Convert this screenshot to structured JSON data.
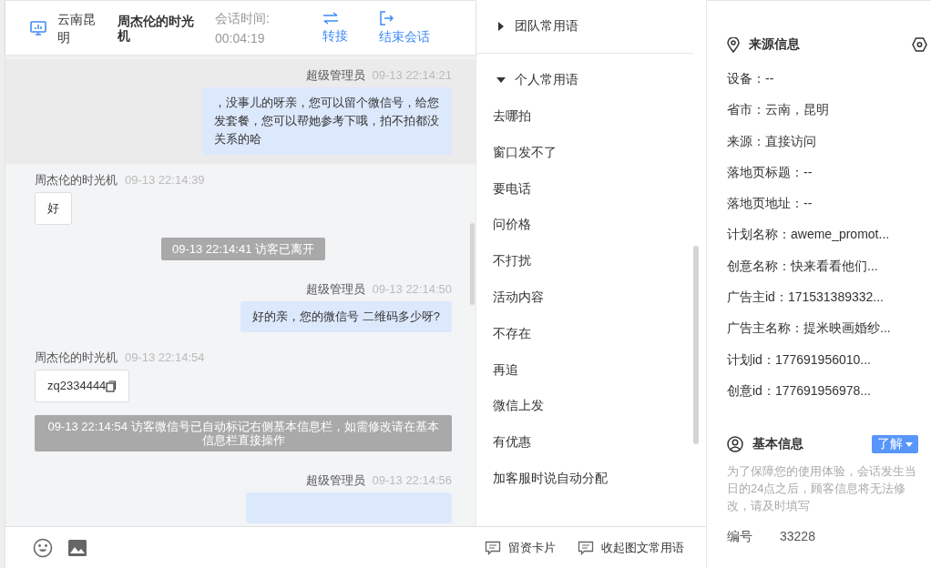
{
  "header": {
    "location": "云南昆明",
    "visitor": "周杰伦的时光机",
    "duration_label": "会话时间:",
    "duration": "00:04:19",
    "actions": [
      {
        "kind": "transfer",
        "label": "转接"
      },
      {
        "kind": "end",
        "label": "结束会话"
      }
    ]
  },
  "messages": [
    {
      "kind": "agent",
      "sender": "超级管理员",
      "time": "09-13 22:14:21",
      "text": "，没事儿的呀亲，您可以留个微信号，给您发套餐，您可以帮她参考下哦，拍不拍都没关系的哈",
      "highlighted": true
    },
    {
      "kind": "visitor",
      "sender": "周杰伦的时光机",
      "time": "09-13 22:14:39",
      "text": "好"
    },
    {
      "kind": "system",
      "text": "09-13 22:14:41 访客已离开"
    },
    {
      "kind": "agent",
      "sender": "超级管理员",
      "time": "09-13 22:14:50",
      "text": "好的亲，您的微信号 二维码多少呀?",
      "highlighted": false
    },
    {
      "kind": "visitor",
      "sender": "周杰伦的时光机",
      "time": "09-13 22:14:54",
      "text": "zq2334444",
      "copyable": true
    },
    {
      "kind": "system",
      "text": "09-13 22:14:54 访客微信号已自动标记右侧基本信息栏，如需修改请在基本信息栏直接操作"
    },
    {
      "kind": "agent",
      "sender": "超级管理员",
      "time": "09-13 22:14:56",
      "highlighted": false
    }
  ],
  "phrases": {
    "groups": [
      {
        "label": "团队常用语",
        "expanded": false
      },
      {
        "label": "个人常用语",
        "expanded": true,
        "items": [
          "去哪拍",
          "窗口发不了",
          "要电话",
          "问价格",
          "不打扰",
          "活动内容",
          "不存在",
          "再追",
          "微信上发",
          "有优惠",
          "加客服时说自动分配"
        ]
      }
    ]
  },
  "toolbar": {
    "buttons": [
      "留资卡片",
      "收起图文常用语"
    ]
  },
  "source_info": {
    "title": "来源信息",
    "lines": [
      "设备：--",
      "省市：云南，昆明",
      "来源：直接访问",
      "落地页标题：--",
      "落地页地址：--",
      "计划名称：aweme_promot...",
      "创意名称：快来看看他们...",
      "广告主id：171531389332...",
      "广告主名称：提米映画婚纱...",
      "计划id：177691956010...",
      "创意id：177691956978..."
    ]
  },
  "basic_info": {
    "title": "基本信息",
    "learn_button": "了解",
    "note": "为了保障您的使用体验，会话发生当日的24点之后，顾客信息将无法修改，请及时填写",
    "fields": [
      {
        "label": "编号",
        "value": "33228"
      }
    ]
  }
}
